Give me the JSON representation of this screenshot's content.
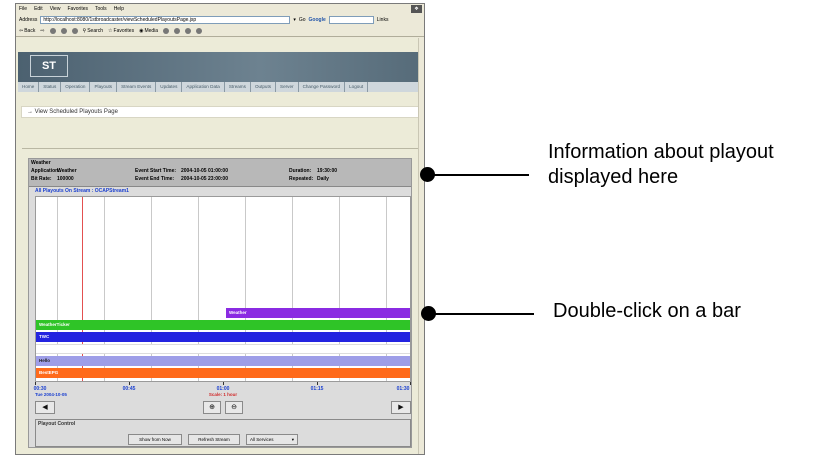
{
  "browser": {
    "menu": [
      "File",
      "Edit",
      "View",
      "Favorites",
      "Tools",
      "Help"
    ],
    "address_label": "Address",
    "url": "http://localhost:8080/1stbroadcaster/viewScheduledPlayoutsPage.jsp",
    "go_label": "Go",
    "google_label": "Google",
    "links_label": "Links",
    "toolbar": [
      "Back",
      "Search",
      "Favorites",
      "Media"
    ]
  },
  "app": {
    "logo": "ST",
    "nav": [
      "Home",
      "Status",
      "Operation",
      "Playouts",
      "Stream Events",
      "Updates",
      "Application Data",
      "Streams",
      "Outputs",
      "Server",
      "Change Password",
      "Logout"
    ],
    "breadcrumb": "→ View Scheduled Playouts Page"
  },
  "panel": {
    "title": "Weather",
    "application_label": "Application:",
    "application_value": "Weather",
    "bitrate_label": "Bit Rate:",
    "bitrate_value": "100000",
    "event_start_label": "Event Start Time:",
    "event_start_value": "2004-10-05 01:00:00",
    "event_end_label": "Event End Time:",
    "event_end_value": "2004-10-05 23:00:00",
    "duration_label": "Duration:",
    "duration_value": "19:30:00",
    "repeated_label": "Repeated:",
    "repeated_value": "Daily",
    "stream_label": "All Playouts On Stream : OCAPStream1"
  },
  "timeline": {
    "bars": [
      {
        "label": "Weather",
        "color": "#8a2be2"
      },
      {
        "label": "WeatherTicker",
        "color": "#2fc427"
      },
      {
        "label": "TWC",
        "color": "#2424e0"
      },
      {
        "label": "",
        "color": "#ffffff"
      },
      {
        "label": "Hello",
        "color": "#9e9ee8"
      },
      {
        "label": "BestEPG",
        "color": "#ff6a1a"
      }
    ],
    "ticks": [
      "00:30",
      "00:45",
      "01:00",
      "01:15",
      "01:30"
    ],
    "date": "Tue 2004-10-05",
    "scale": "Scale: 1 hour"
  },
  "controls": {
    "label": "Playout Control",
    "show_from_now": "Show from Now",
    "refresh_stream": "Refresh Stream",
    "services": "All Services"
  },
  "callouts": {
    "info": "Information about playout displayed here",
    "doubleclick": "Double-click on a bar"
  }
}
